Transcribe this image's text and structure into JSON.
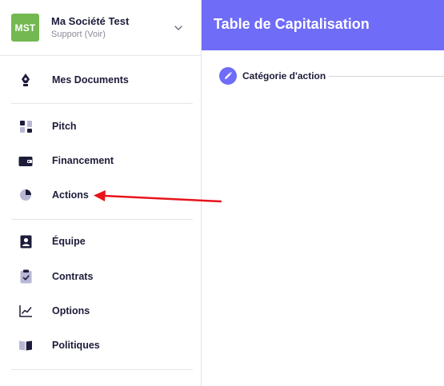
{
  "company": {
    "avatar_initials": "MST",
    "name": "Ma Société Test",
    "role": "Support (Voir)"
  },
  "nav": {
    "documents": {
      "label": "Mes Documents",
      "icon": "pen-nib-icon"
    },
    "pitch": {
      "label": "Pitch",
      "icon": "layout-blocks-icon"
    },
    "financement": {
      "label": "Financement",
      "icon": "wallet-icon"
    },
    "actions": {
      "label": "Actions",
      "icon": "pie-chart-icon"
    },
    "equipe": {
      "label": "Équipe",
      "icon": "person-badge-icon"
    },
    "contrats": {
      "label": "Contrats",
      "icon": "clipboard-check-icon"
    },
    "options": {
      "label": "Options",
      "icon": "line-chart-icon"
    },
    "politiques": {
      "label": "Politiques",
      "icon": "open-book-icon"
    }
  },
  "header": {
    "title": "Table de Capitalisation"
  },
  "stepper": {
    "step1_label": "Catégorie d'action",
    "step1_icon": "pencil-icon"
  },
  "colors": {
    "accent": "#6f6cf7",
    "avatar": "#73b850",
    "text_dark": "#1c1c3a",
    "annotation_arrow": "#e8141b"
  }
}
